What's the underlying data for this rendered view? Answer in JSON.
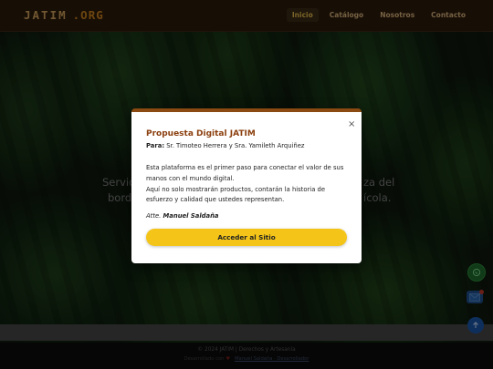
{
  "site": {
    "logo_main": "JATIM",
    "logo_domain": ".ORG"
  },
  "nav": {
    "items": [
      {
        "label": "Inicio",
        "active": true
      },
      {
        "label": "Catálogo",
        "active": false
      },
      {
        "label": "Nosotros",
        "active": false
      },
      {
        "label": "Contacto",
        "active": false
      }
    ]
  },
  "hero": {
    "line1_left": "Servic",
    "line1_right": "za del",
    "line2_left": "borda",
    "line2_right": "ícola."
  },
  "modal": {
    "close_symbol": "×",
    "title": "Propuesta Digital JATIM",
    "para_label": "Para:",
    "para_value": "Sr. Timoteo Herrera y Sra. Yamileth Arquiñez",
    "body_line1": "Esta plataforma es el primer paso para conectar el valor de sus",
    "body_line2": "manos con el mundo digital.",
    "body_line3": "Aquí no solo mostrarán productos, contarán la historia de",
    "body_line4": "esfuerzo y calidad que ustedes representan.",
    "sign_prefix": "Atte.",
    "sign_name": "Manuel Saldaña",
    "button_label": "Acceder al Sitio"
  },
  "footer": {
    "copyright": "© 2024 JATIM | Derechos y Artesanía",
    "credit_text": "Desarrollado con",
    "credit_link": "Manuel Saldaña · Desarrollador"
  },
  "fabs": {
    "whatsapp_icon": "whatsapp-icon",
    "mail_icon": "mail-icon",
    "top_icon": "arrow-up-icon"
  },
  "colors": {
    "header_bg": "#2a1a0c",
    "accent_gold": "#cfa15b",
    "modal_title": "#8b3f0e",
    "button_bg": "#f4c518"
  }
}
